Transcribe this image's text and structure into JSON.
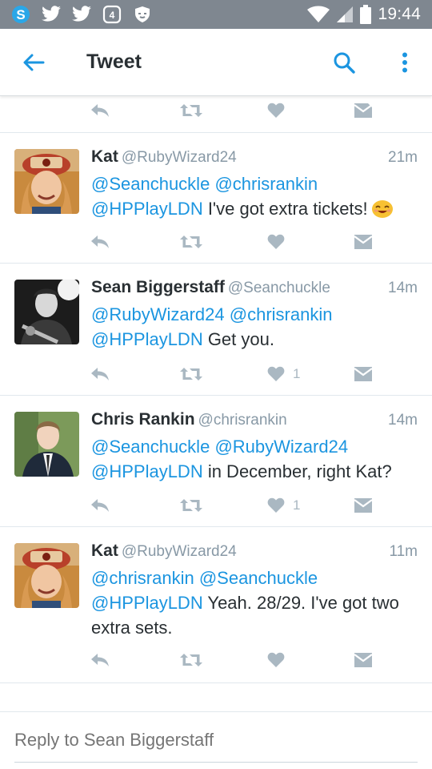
{
  "statusbar": {
    "time": "19:44",
    "notif_badge": "4",
    "left_icons": [
      "skype-icon",
      "twitter-icon",
      "twitter-icon",
      "notification-icon",
      "shield-icon"
    ],
    "right_icons": [
      "wifi-icon",
      "signal-icon",
      "battery-icon"
    ]
  },
  "appbar": {
    "title": "Tweet",
    "back_icon": "arrow-left-icon",
    "search_icon": "search-icon",
    "more_icon": "more-vertical-icon",
    "accent": "#1b95e0"
  },
  "tweets": [
    {
      "name": "Kat",
      "handle": "@RubyWizard24",
      "time": "21m",
      "text": [
        {
          "t": "@Seanchuckle",
          "m": true
        },
        {
          "t": " ",
          "m": false
        },
        {
          "t": "@chrisrankin",
          "m": true
        },
        {
          "t": " ",
          "m": false
        },
        {
          "t": "@HPPlayLDN",
          "m": true
        },
        {
          "t": " I've got extra tickets!",
          "m": false
        }
      ],
      "emoji": "smiling-face-emoji",
      "like_count": ""
    },
    {
      "name": "Sean Biggerstaff",
      "handle": "@Seanchuckle",
      "time": "14m",
      "text": [
        {
          "t": "@RubyWizard24",
          "m": true
        },
        {
          "t": " ",
          "m": false
        },
        {
          "t": "@chrisrankin",
          "m": true
        },
        {
          "t": " ",
          "m": false
        },
        {
          "t": "@HPPlayLDN",
          "m": true
        },
        {
          "t": " Get you.",
          "m": false
        }
      ],
      "emoji": "",
      "like_count": "1"
    },
    {
      "name": "Chris Rankin",
      "handle": "@chrisrankin",
      "time": "14m",
      "text": [
        {
          "t": "@Seanchuckle",
          "m": true
        },
        {
          "t": " ",
          "m": false
        },
        {
          "t": "@RubyWizard24",
          "m": true
        },
        {
          "t": " ",
          "m": false
        },
        {
          "t": "@HPPlayLDN",
          "m": true
        },
        {
          "t": " in December, right Kat?",
          "m": false
        }
      ],
      "emoji": "",
      "like_count": "1"
    },
    {
      "name": "Kat",
      "handle": "@RubyWizard24",
      "time": "11m",
      "text": [
        {
          "t": "@chrisrankin",
          "m": true
        },
        {
          "t": " ",
          "m": false
        },
        {
          "t": "@Seanchuckle",
          "m": true
        },
        {
          "t": " ",
          "m": false
        },
        {
          "t": "@HPPlayLDN",
          "m": true
        },
        {
          "t": " Yeah. 28/29. I've got two extra sets.",
          "m": false
        }
      ],
      "emoji": "",
      "like_count": ""
    }
  ],
  "action_icons": [
    "reply-icon",
    "retweet-icon",
    "heart-icon",
    "direct-message-icon"
  ],
  "reply": {
    "placeholder": "Reply to Sean Biggerstaff"
  },
  "colors": {
    "statusbar": "#7f8790",
    "mention": "#1b95e0",
    "action_gray": "#aab8c2",
    "meta_gray": "#8899a6"
  }
}
